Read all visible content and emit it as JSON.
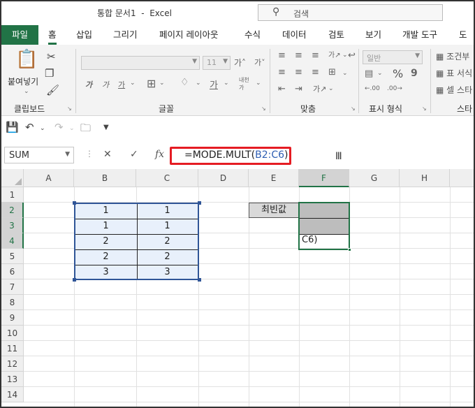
{
  "window": {
    "title": "통합 문서1  -  Excel",
    "search_placeholder": "검색"
  },
  "ribbon_tabs": [
    "파일",
    "홈",
    "삽입",
    "그리기",
    "페이지 레이아웃",
    "수식",
    "데이터",
    "검토",
    "보기",
    "개발 도구",
    "도움"
  ],
  "ribbon": {
    "paste_label": "붙여넣기",
    "font_size_value": "11",
    "number_format_value": "일반",
    "groups": [
      "클립보드",
      "글꼴",
      "맞춤",
      "표시 형식",
      "스타"
    ],
    "styles_items": [
      "조건부",
      "표 서식",
      "셀 스타"
    ]
  },
  "formula_bar": {
    "name_box": "SUM",
    "formula_prefix": "=MODE.MULT(",
    "formula_ref": "B2:C6",
    "formula_suffix": ")"
  },
  "sheet": {
    "columns": [
      "A",
      "B",
      "C",
      "D",
      "E",
      "F",
      "G",
      "H"
    ],
    "rows": [
      "1",
      "2",
      "3",
      "4",
      "5",
      "6",
      "7",
      "8",
      "9",
      "10",
      "11",
      "12",
      "13",
      "14"
    ],
    "data_b": [
      "1",
      "1",
      "2",
      "2",
      "3"
    ],
    "data_c": [
      "1",
      "1",
      "2",
      "2",
      "3"
    ],
    "label_e2": "최빈값",
    "f4_edit_text": "C6)"
  },
  "colors": {
    "excel_green": "#217346",
    "range_blue": "#2f5597",
    "highlight_red": "#e51c23"
  }
}
